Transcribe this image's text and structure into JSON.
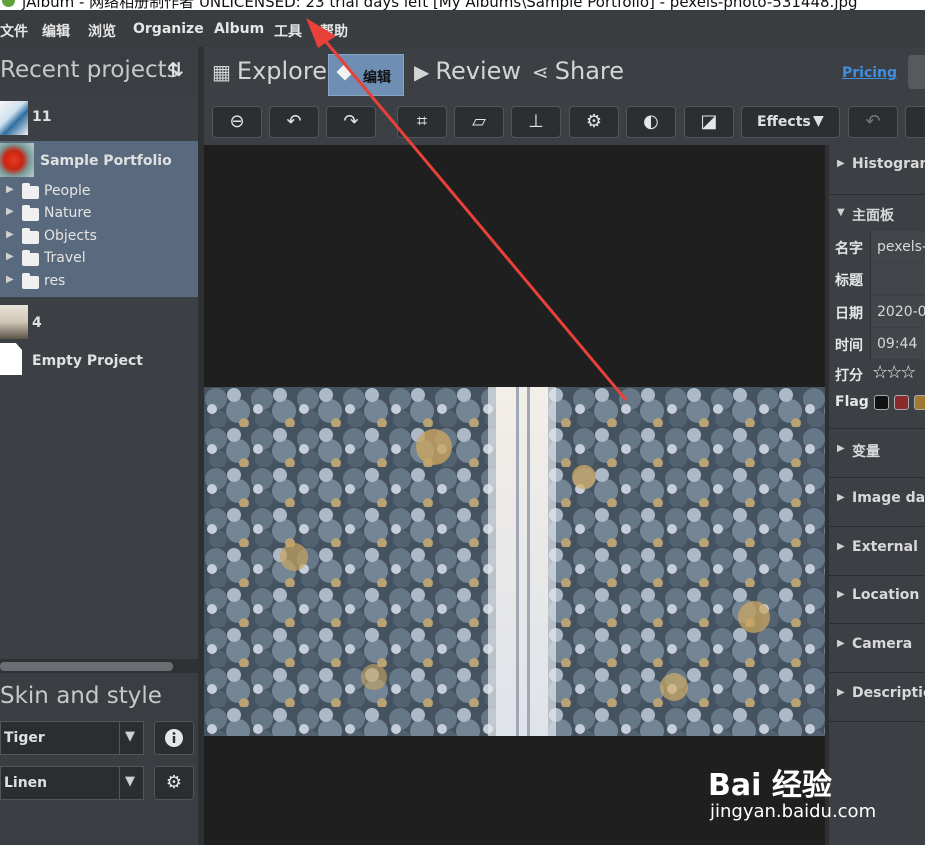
{
  "window": {
    "title": "jAlbum - 网络相册制作者 UNLICENSED: 23 trial days left [My Albums\\Sample Portfolio] - pexels-photo-531448.jpg"
  },
  "menu": [
    "文件",
    "编辑",
    "浏览",
    "Organize",
    "Album",
    "工具",
    "帮助"
  ],
  "left_panel": {
    "recent_title": "Recent projects",
    "projects": [
      {
        "name": "11"
      },
      {
        "name": "Sample Portfolio",
        "folders": [
          "People",
          "Nature",
          "Objects",
          "Travel",
          "res"
        ]
      },
      {
        "name": "4"
      },
      {
        "name": "Empty Project"
      }
    ],
    "skin_title": "Skin and style",
    "skin_value": "Tiger",
    "style_value": "Linen"
  },
  "tabs": {
    "explore": "Explore",
    "edit": "编辑",
    "review": "Review",
    "share": "Share",
    "pricing": "Pricing"
  },
  "toolbar": {
    "effects": "Effects"
  },
  "right_panel": {
    "histogram": "Histogram",
    "main_panel": "主面板",
    "props": {
      "name_label": "名字",
      "name_value": "pexels-",
      "title_label": "标题",
      "date_label": "日期",
      "date_value": "2020-0",
      "time_label": "时间",
      "time_value": "09:44",
      "rating_label": "打分",
      "flag_label": "Flag"
    },
    "sections": [
      "变量",
      "Image data",
      "External",
      "Location",
      "Camera",
      "Description"
    ]
  },
  "colors": {
    "accent": "#6f8eb3",
    "link": "#3f8fe0",
    "annotation_arrow": "#e8413a",
    "flags": [
      "#111111",
      "#8b2a2a",
      "#a07a30"
    ]
  },
  "watermark": {
    "logo": "Bai 经验",
    "url": "jingyan.baidu.com"
  }
}
